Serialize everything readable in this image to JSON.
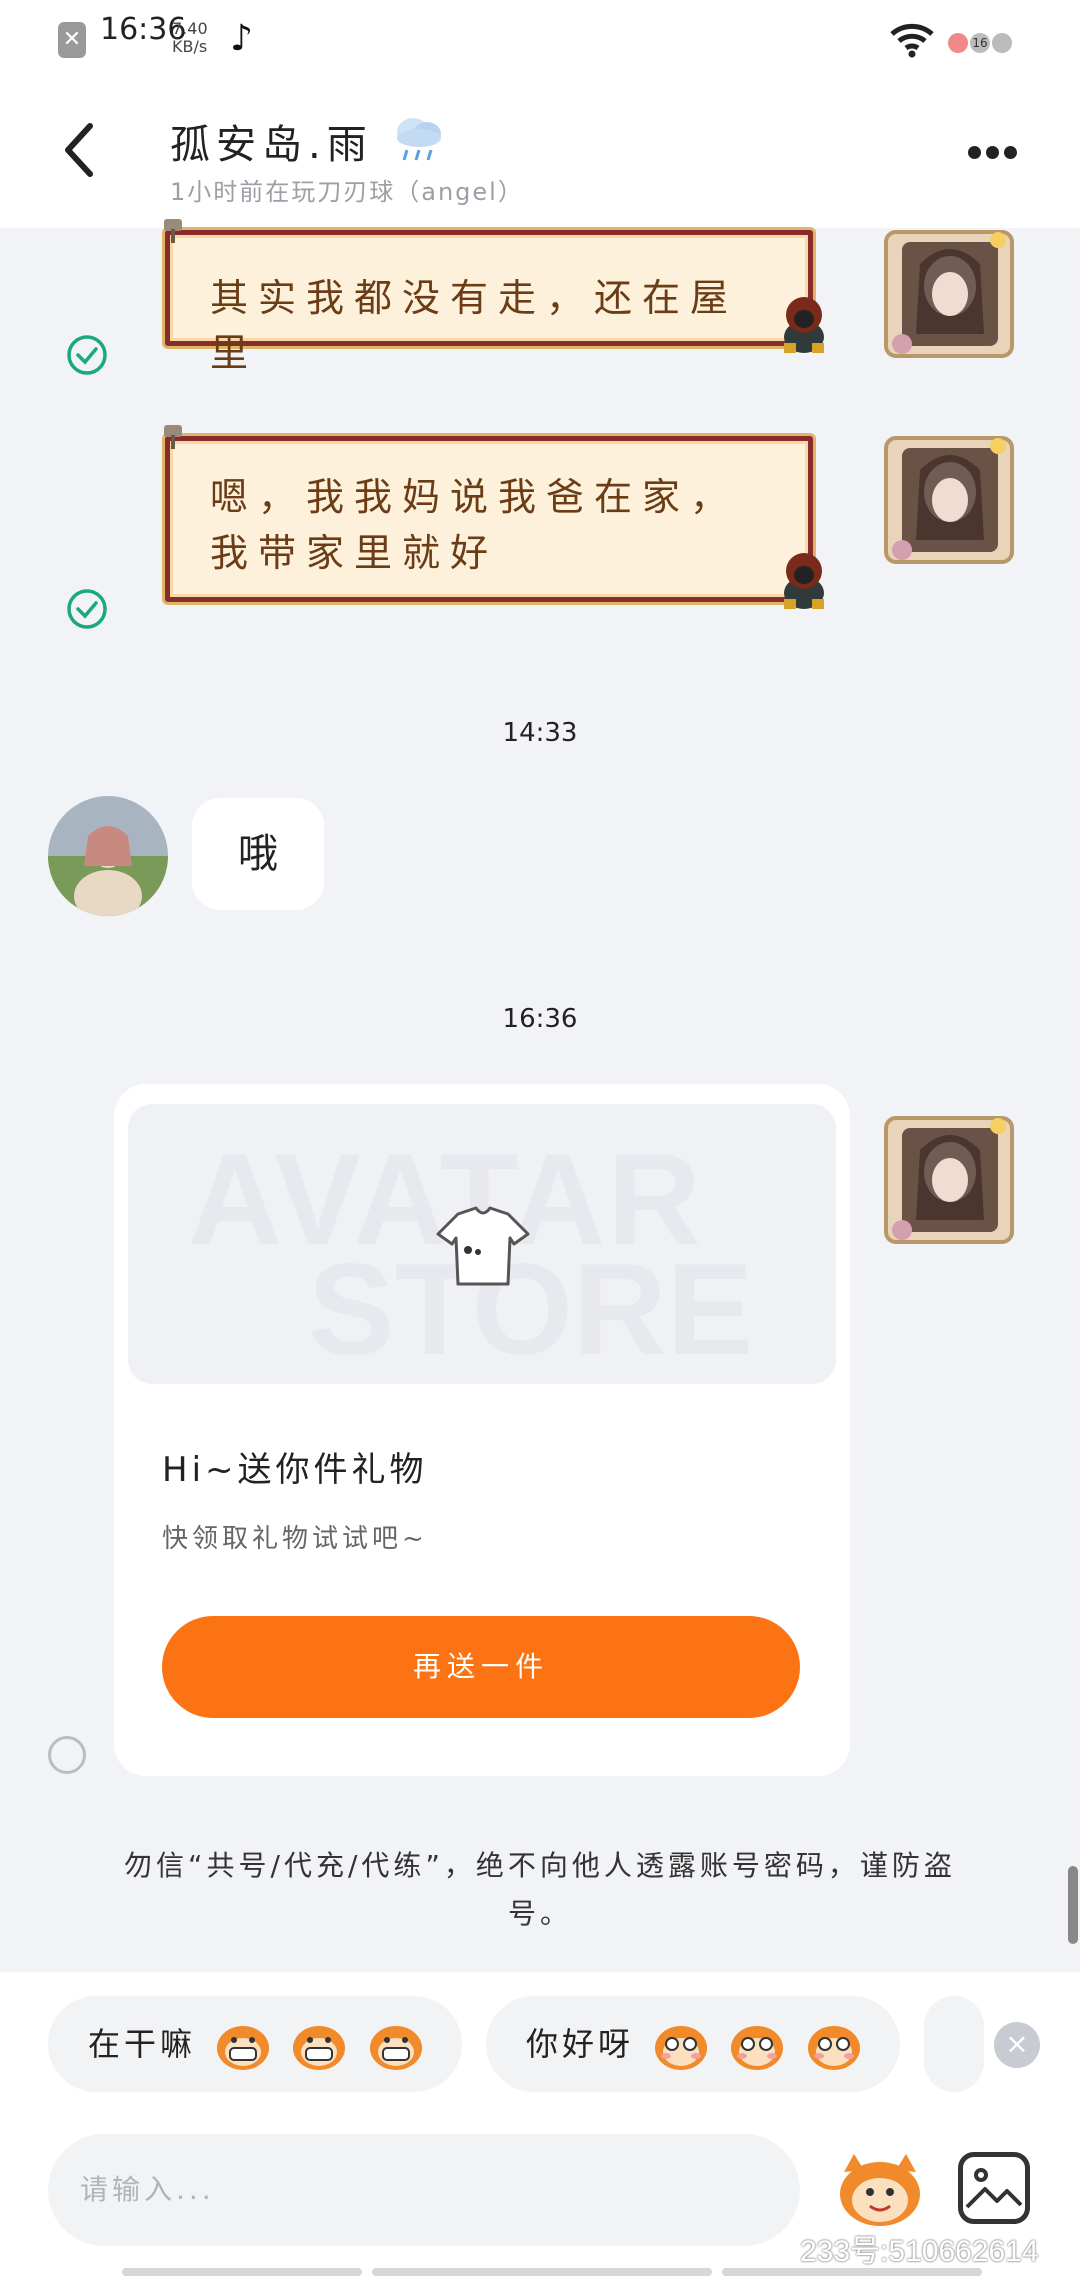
{
  "status_bar": {
    "time": "16:36",
    "speed_value": "7.40",
    "speed_unit": "KB/s",
    "badge": "16"
  },
  "header": {
    "contact_name": "孤安岛.雨",
    "presence": "1小时前在玩刀刃球（angel）"
  },
  "messages": [
    {
      "side": "right",
      "text": "其实我都没有走，还在屋里",
      "status": "read"
    },
    {
      "side": "right",
      "text": "嗯，我我妈说我爸在家，我带家里就好",
      "status": "read"
    },
    {
      "type": "time",
      "text": "14:33"
    },
    {
      "side": "left",
      "text": "哦"
    },
    {
      "type": "time",
      "text": "16:36"
    }
  ],
  "gift_card": {
    "watermark_line1": "AVATAR",
    "watermark_line2": "STORE",
    "title": "Hi~送你件礼物",
    "subtitle": "快领取礼物试试吧~",
    "button_label": "再送一件"
  },
  "warning": "勿信“共号/代充/代练”，绝不向他人透露账号密码，谨防盗号。",
  "quick_replies": [
    {
      "label": "在干嘛",
      "emoji": "grinning-monkey"
    },
    {
      "label": "你好呀",
      "emoji": "shy-monkey"
    }
  ],
  "input": {
    "placeholder": "请输入..."
  },
  "watermark": "233号:510662614",
  "colors": {
    "accent": "#fb7313",
    "frame": "#8a2b2b",
    "check": "#1aaa7a"
  }
}
